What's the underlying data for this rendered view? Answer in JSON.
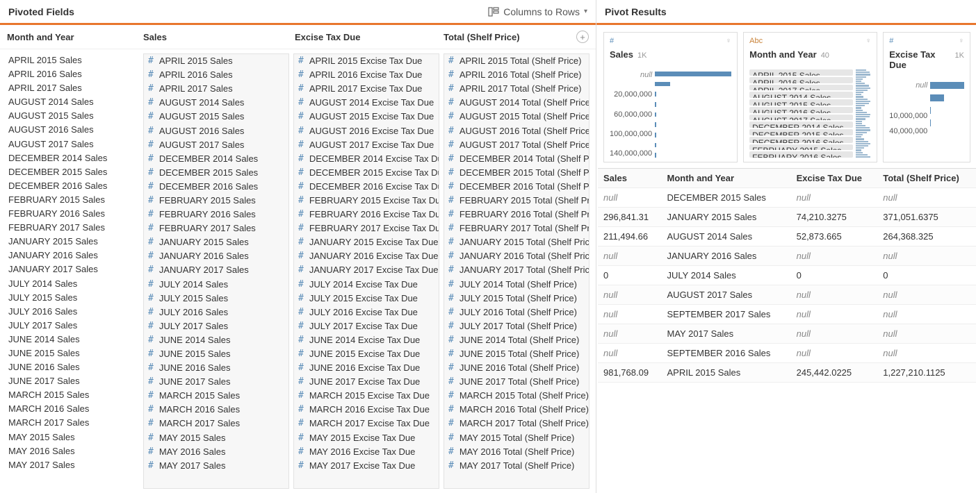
{
  "left": {
    "title": "Pivoted Fields",
    "action_label": "Columns to Rows",
    "columns": [
      "Month and Year",
      "Sales",
      "Excise Tax Due",
      "Total (Shelf Price)"
    ],
    "months": [
      "APRIL 2015",
      "APRIL 2016",
      "APRIL 2017",
      "AUGUST 2014",
      "AUGUST 2015",
      "AUGUST 2016",
      "AUGUST 2017",
      "DECEMBER 2014",
      "DECEMBER 2015",
      "DECEMBER 2016",
      "FEBRUARY 2015",
      "FEBRUARY 2016",
      "FEBRUARY 2017",
      "JANUARY 2015",
      "JANUARY 2016",
      "JANUARY 2017",
      "JULY 2014",
      "JULY 2015",
      "JULY 2016",
      "JULY 2017",
      "JUNE 2014",
      "JUNE 2015",
      "JUNE 2016",
      "JUNE 2017",
      "MARCH 2015",
      "MARCH 2016",
      "MARCH 2017",
      "MAY 2015",
      "MAY 2016",
      "MAY 2017"
    ],
    "suffixes": {
      "0": " Sales",
      "1": " Sales",
      "2": " Excise Tax Due",
      "3": " Total (Shelf Price)"
    }
  },
  "right": {
    "title": "Pivot Results",
    "cards": [
      {
        "type": "#",
        "name": "Sales",
        "count": "1K",
        "axis": [
          "null",
          "",
          "20,000,000",
          "",
          "60,000,000",
          "",
          "100,000,000",
          "",
          "140,000,000"
        ],
        "bars": [
          100,
          20,
          2,
          2,
          2,
          2,
          2,
          2,
          2
        ]
      },
      {
        "type": "Abc",
        "name": "Month and Year",
        "count": "40",
        "tags": [
          "APRIL 2015 Sales",
          "APRIL 2016 Sales",
          "APRIL 2017 Sales",
          "AUGUST 2014 Sales",
          "AUGUST 2015 Sales",
          "AUGUST 2016 Sales",
          "AUGUST 2017 Sales",
          "DECEMBER 2014 Sales",
          "DECEMBER 2015 Sales",
          "DECEMBER 2016 Sales",
          "FEBRUARY 2015 Sales",
          "FEBRUARY 2016 Sales"
        ]
      },
      {
        "type": "#",
        "name": "Excise Tax Due",
        "count": "1K",
        "axis": [
          "null",
          "",
          "10,000,000",
          "40,000,000"
        ],
        "bars": [
          100,
          40,
          2,
          2
        ]
      }
    ],
    "table": {
      "headers": [
        "Sales",
        "Month and Year",
        "Excise Tax Due",
        "Total (Shelf Price)"
      ],
      "rows": [
        [
          "null",
          "DECEMBER 2015 Sales",
          "null",
          "null"
        ],
        [
          "296,841.31",
          "JANUARY 2015 Sales",
          "74,210.3275",
          "371,051.6375"
        ],
        [
          "211,494.66",
          "AUGUST 2014 Sales",
          "52,873.665",
          "264,368.325"
        ],
        [
          "null",
          "JANUARY 2016 Sales",
          "null",
          "null"
        ],
        [
          "0",
          "JULY 2014 Sales",
          "0",
          "0"
        ],
        [
          "null",
          "AUGUST 2017 Sales",
          "null",
          "null"
        ],
        [
          "null",
          "SEPTEMBER 2017 Sales",
          "null",
          "null"
        ],
        [
          "null",
          "MAY 2017 Sales",
          "null",
          "null"
        ],
        [
          "null",
          "SEPTEMBER 2016 Sales",
          "null",
          "null"
        ],
        [
          "981,768.09",
          "APRIL 2015 Sales",
          "245,442.0225",
          "1,227,210.1125"
        ]
      ]
    }
  }
}
